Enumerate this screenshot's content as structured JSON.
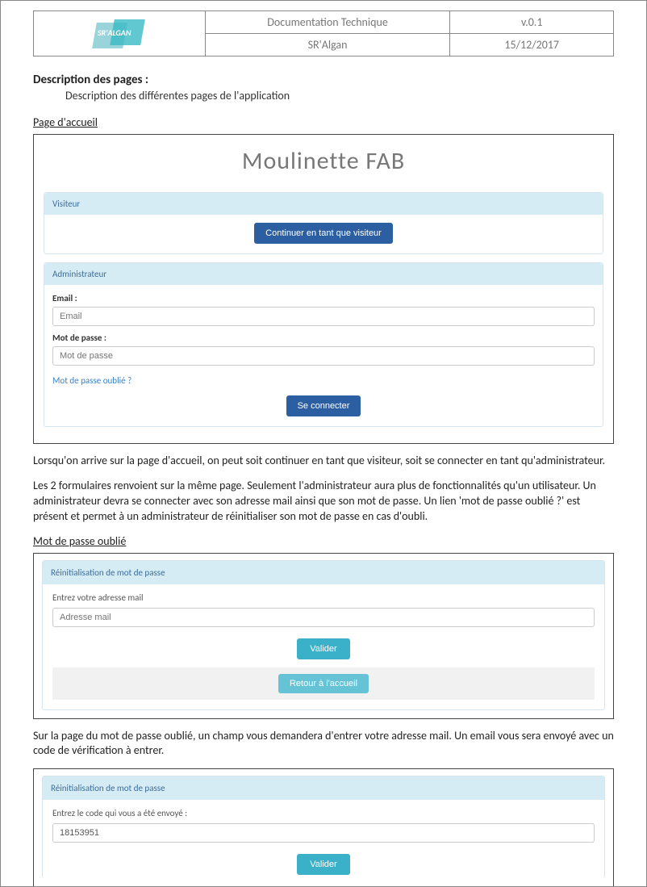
{
  "header": {
    "doc_type": "Documentation Technique",
    "version": "v.0.1",
    "project": "SR'Algan",
    "date": "15/12/2017",
    "logo_text": "SR'ALGAN"
  },
  "section": {
    "title": "Description des pages :",
    "intro": "Description des différentes pages de l'application"
  },
  "home": {
    "heading": "Page d'accueil",
    "app_title": "Moulinette FAB",
    "visitor": {
      "panel_title": "Visiteur",
      "button": "Continuer en tant que visiteur"
    },
    "admin": {
      "panel_title": "Administrateur",
      "email_label": "Email :",
      "email_placeholder": "Email",
      "pwd_label": "Mot de passe :",
      "pwd_placeholder": "Mot de passe",
      "forgot_link": "Mot de passe oublié ?",
      "submit": "Se connecter"
    },
    "para1": "Lorsqu'on arrive sur la page d'accueil, on peut soit continuer en tant que visiteur, soit se connecter en tant qu'administrateur.",
    "para2": "Les 2 formulaires renvoient sur la même page. Seulement l'administrateur aura plus de fonctionnalités qu'un utilisateur. Un administrateur devra se connecter avec son adresse mail ainsi que son mot de passe. Un lien 'mot de passe oublié ?' est présent et permet à un administrateur de réinitialiser son mot de passe en cas d'oubli."
  },
  "forgot": {
    "heading": "Mot de passe oublié",
    "panel_title": "Réinitialisation de mot de passe",
    "email_label": "Entrez votre adresse mail",
    "email_placeholder": "Adresse mail",
    "validate": "Valider",
    "back": "Retour à l'accueil",
    "para": "Sur la page du mot de passe oublié, un champ vous demandera d'entrer votre adresse mail. Un email vous sera envoyé avec un code de vérification à entrer."
  },
  "code": {
    "panel_title": "Réinitialisation de mot de passe",
    "code_label": "Entrez le code qui vous a été envoyé :",
    "code_value": "18153951",
    "validate": "Valider"
  }
}
